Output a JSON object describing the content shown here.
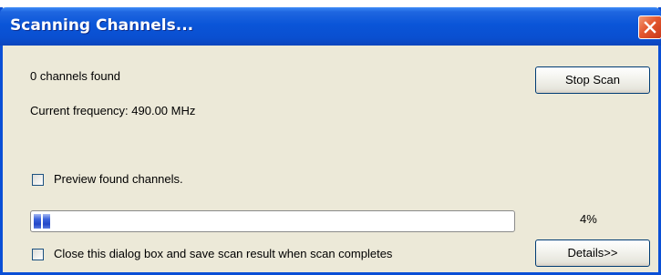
{
  "window": {
    "title": "Scanning Channels...",
    "close_icon": "close-x-icon",
    "accent_color": "#0a55d8"
  },
  "status": {
    "channels_found": "0 channels found",
    "current_frequency": "Current frequency: 490.00 MHz"
  },
  "buttons": {
    "stop_scan": "Stop Scan",
    "details": "Details>>"
  },
  "options": {
    "preview_label": "Preview found channels.",
    "preview_checked": false,
    "close_save_label": "Close this dialog box and save scan result when scan completes",
    "close_save_checked": false
  },
  "progress": {
    "value": 0.04,
    "percent_text": "4%",
    "fill_color": "#2347c7"
  }
}
